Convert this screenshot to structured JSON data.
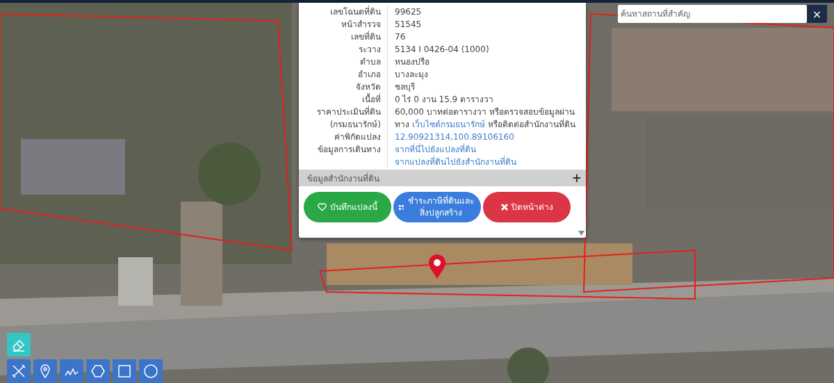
{
  "search": {
    "placeholder": "ค้นหาสถานที่สำคัญ",
    "clear_label": "×"
  },
  "popup": {
    "rows": [
      {
        "label": "เลขโฉนดที่ดิน",
        "kind": "text",
        "value": "99625"
      },
      {
        "label": "หน้าสำรวจ",
        "kind": "text",
        "value": "51545"
      },
      {
        "label": "เลขที่ดิน",
        "kind": "text",
        "value": "76"
      },
      {
        "label": "ระวาง",
        "kind": "text",
        "value": "5134 I 0426-04 (1000)"
      },
      {
        "label": "ตำบล",
        "kind": "text",
        "value": "หนองปรือ"
      },
      {
        "label": "อำเภอ",
        "kind": "text",
        "value": "บางละมุง"
      },
      {
        "label": "จังหวัด",
        "kind": "text",
        "value": "ชลบุรี"
      },
      {
        "label": "เนื้อที่",
        "kind": "text",
        "value": "0 ไร่ 0 งาน 15.9 ตารางวา"
      },
      {
        "label": "ราคาประเมินที่ดิน (กรมธนารักษ์)",
        "kind": "rich",
        "parts": [
          {
            "kind": "text",
            "text": "60,000 บาทต่อตารางวา หรือตรวจสอบข้อมูลผ่านทาง"
          },
          {
            "kind": "link",
            "text": "เว็บไซต์กรมธนารักษ์"
          },
          {
            "kind": "text",
            "text": "หรือติดต่อสำนักงานที่ดิน"
          }
        ]
      },
      {
        "label": "ค่าพิกัดแปลง",
        "kind": "links",
        "links": [
          "12.90921314,100.89106160"
        ]
      },
      {
        "label": "ข้อมูลการเดินทาง",
        "kind": "links",
        "links": [
          "จากที่นี่ไปยังแปลงที่ดิน",
          "จากแปลงที่ดินไปยังสำนักงานที่ดิน"
        ]
      }
    ],
    "section": {
      "title": "ข้อมูลสำนักงานที่ดิน",
      "toggle": "+",
      "expanded": false
    },
    "buttons": [
      {
        "kind": "save",
        "label": "บันทึกแปลงนี้"
      },
      {
        "kind": "tax",
        "label": "ชำระภาษีที่ดินและสิ่งปลูกสร้าง"
      },
      {
        "kind": "close",
        "label": "ปิดหน้าต่าง"
      }
    ]
  },
  "edit_tool": {
    "kind": "eraser"
  },
  "draw_tools": [
    {
      "kind": "cross"
    },
    {
      "kind": "pin"
    },
    {
      "kind": "line"
    },
    {
      "kind": "polygon"
    },
    {
      "kind": "rectangle"
    },
    {
      "kind": "circle"
    }
  ]
}
